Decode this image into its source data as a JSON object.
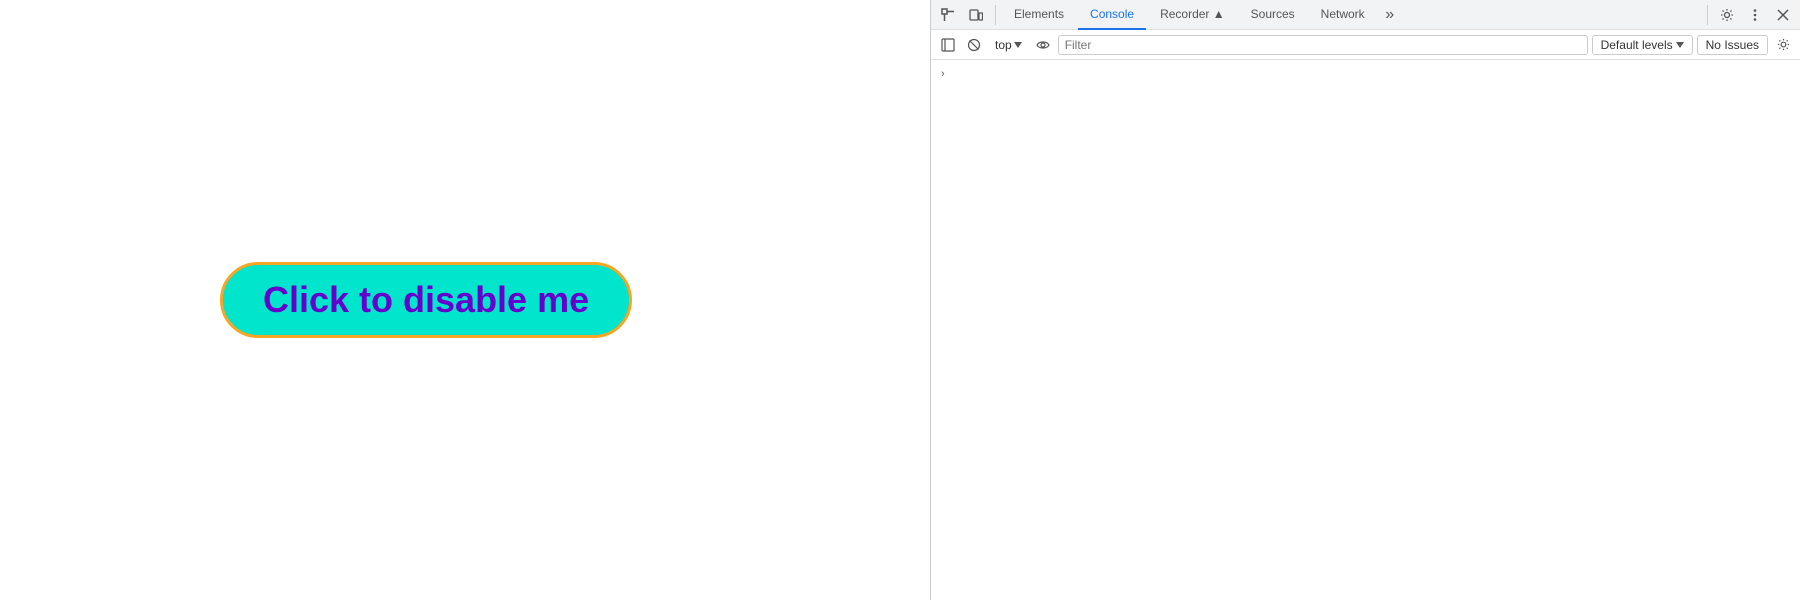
{
  "page": {
    "button_label": "Click to disable me"
  },
  "devtools": {
    "tabs": [
      {
        "id": "elements",
        "label": "Elements",
        "active": false
      },
      {
        "id": "console",
        "label": "Console",
        "active": true
      },
      {
        "id": "recorder",
        "label": "Recorder ▲",
        "active": false
      },
      {
        "id": "sources",
        "label": "Sources",
        "active": false
      },
      {
        "id": "network",
        "label": "Network",
        "active": false
      }
    ],
    "console_bar": {
      "context": "top",
      "filter_placeholder": "Filter",
      "levels_label": "Default levels",
      "issues_label": "No Issues"
    }
  }
}
